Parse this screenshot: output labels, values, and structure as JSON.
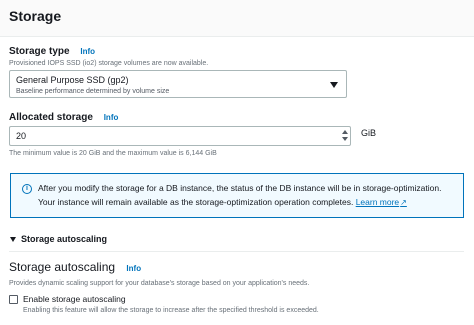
{
  "header": {
    "title": "Storage"
  },
  "storage_type": {
    "label": "Storage type",
    "info": "Info",
    "description": "Provisioned IOPS SSD (io2) storage volumes are now available.",
    "selected_value": "General Purpose SSD (gp2)",
    "selected_description": "Baseline performance determined by volume size"
  },
  "allocated_storage": {
    "label": "Allocated storage",
    "info": "Info",
    "value": "20",
    "unit": "GiB",
    "hint": "The minimum value is 20 GiB and the maximum value is 6,144 GiB"
  },
  "alert": {
    "icon": "info-circle-icon",
    "text": "After you modify the storage for a DB instance, the status of the DB instance will be in storage-optimization. Your instance will remain available as the storage-optimization operation completes.",
    "link": "Learn more"
  },
  "autoscaling_expander": {
    "label": "Storage autoscaling"
  },
  "autoscaling": {
    "title": "Storage autoscaling",
    "info": "Info",
    "description": "Provides dynamic scaling support for your database's storage based on your application's needs.",
    "checkbox_label": "Enable storage autoscaling",
    "checkbox_checked": false,
    "checkbox_description": "Enabling this feature will allow the storage to increase after the specified threshold is exceeded."
  },
  "colors": {
    "accent": "#0073bb",
    "alert_bg": "#f1faff",
    "text": "#16191f",
    "muted": "#687078"
  }
}
